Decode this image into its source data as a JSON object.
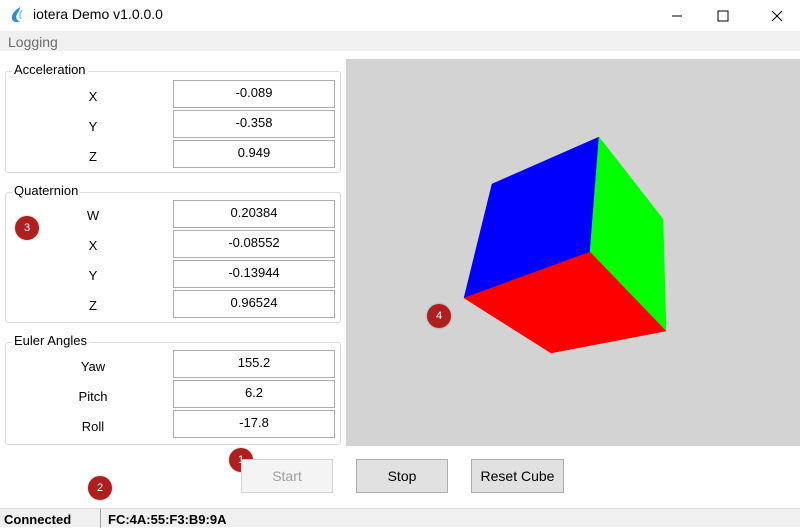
{
  "window": {
    "title": "iotera Demo v1.0.0.0"
  },
  "menu": {
    "items": [
      "Logging"
    ]
  },
  "acceleration": {
    "title": "Acceleration",
    "rows": [
      {
        "label": "X",
        "value": "-0.089"
      },
      {
        "label": "Y",
        "value": "-0.358"
      },
      {
        "label": "Z",
        "value": "0.949"
      }
    ]
  },
  "quaternion": {
    "title": "Quaternion",
    "rows": [
      {
        "label": "W",
        "value": "0.20384"
      },
      {
        "label": "X",
        "value": "-0.08552"
      },
      {
        "label": "Y",
        "value": "-0.13944"
      },
      {
        "label": "Z",
        "value": "0.96524"
      }
    ]
  },
  "euler": {
    "title": "Euler Angles",
    "rows": [
      {
        "label": "Yaw",
        "value": "155.2"
      },
      {
        "label": "Pitch",
        "value": "6.2"
      },
      {
        "label": "Roll",
        "value": "-17.8"
      }
    ]
  },
  "buttons": {
    "start": "Start",
    "stop": "Stop",
    "reset": "Reset Cube"
  },
  "badges": {
    "b1": "1",
    "b2": "2",
    "b3": "3",
    "b4": "4"
  },
  "status": {
    "connection": "Connected",
    "device": "FC:4A:55:F3:B9:9A"
  },
  "colors": {
    "cube_top": "#0000ff",
    "cube_right": "#00ff00",
    "cube_front": "#ff0000",
    "viewport_bg": "#d3d3d3",
    "badge": "#b01f1f"
  },
  "icons": {
    "app": "droplet-icon",
    "minimize": "minimize-icon",
    "maximize": "maximize-icon",
    "close": "close-icon"
  }
}
